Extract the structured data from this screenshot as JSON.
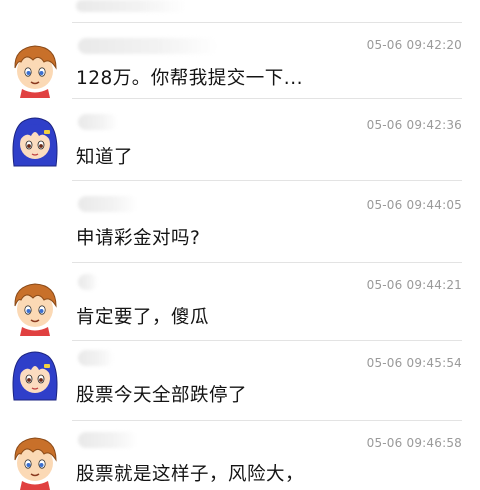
{
  "messages": [
    {
      "sender": "",
      "time": "",
      "text": ""
    },
    {
      "sender": "boy",
      "time": "05-06 09:42:20",
      "text": "128万。你帮我提交一下..."
    },
    {
      "sender": "girl",
      "time": "05-06 09:42:36",
      "text": "知道了"
    },
    {
      "sender": "",
      "time": "05-06 09:44:05",
      "text": "申请彩金对吗?"
    },
    {
      "sender": "boy",
      "time": "05-06 09:44:21",
      "text": "肯定要了，傻瓜"
    },
    {
      "sender": "girl",
      "time": "05-06 09:45:54",
      "text": "股票今天全部跌停了"
    },
    {
      "sender": "boy",
      "time": "05-06 09:46:58",
      "text": "股票就是这样子，风险大，"
    }
  ],
  "avatars": {
    "boy": {
      "icon": "boy-avatar-icon",
      "hair": "#c8702a",
      "skin": "#fbd9b5"
    },
    "girl": {
      "icon": "girl-avatar-icon",
      "hair": "#2f3fc9",
      "skin": "#fbdcc0"
    }
  }
}
